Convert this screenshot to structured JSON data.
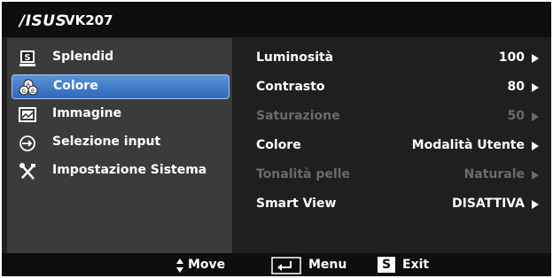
{
  "header": {
    "brand": "/ISUS",
    "model": "VK207"
  },
  "sidebar": {
    "items": [
      {
        "label": "Splendid",
        "icon": "splendid-icon",
        "active": false
      },
      {
        "label": "Colore",
        "icon": "color-palette-icon",
        "active": true
      },
      {
        "label": "Immagine",
        "icon": "image-icon",
        "active": false
      },
      {
        "label": "Selezione input",
        "icon": "input-select-icon",
        "active": false
      },
      {
        "label": "Impostazione Sistema",
        "icon": "tools-icon",
        "active": false
      }
    ]
  },
  "settings": {
    "rows": [
      {
        "label": "Luminosità",
        "value": "100",
        "enabled": true
      },
      {
        "label": "Contrasto",
        "value": "80",
        "enabled": true
      },
      {
        "label": "Saturazione",
        "value": "50",
        "enabled": false
      },
      {
        "label": "Colore",
        "value": "Modalità Utente",
        "enabled": true
      },
      {
        "label": "Tonalità pelle",
        "value": "Naturale",
        "enabled": false
      },
      {
        "label": "Smart View",
        "value": "DISATTIVA",
        "enabled": true
      }
    ]
  },
  "footer": {
    "move_label": "Move",
    "menu_label": "Menu",
    "exit_label": "Exit",
    "exit_key": "S"
  },
  "colors": {
    "active_item": "#3d78c8",
    "sidebar_bg": "#3b3b3b",
    "panel_bg": "#1f1f1f",
    "bar_bg": "#0e0e0e",
    "disabled_text": "#6b6b6b"
  }
}
